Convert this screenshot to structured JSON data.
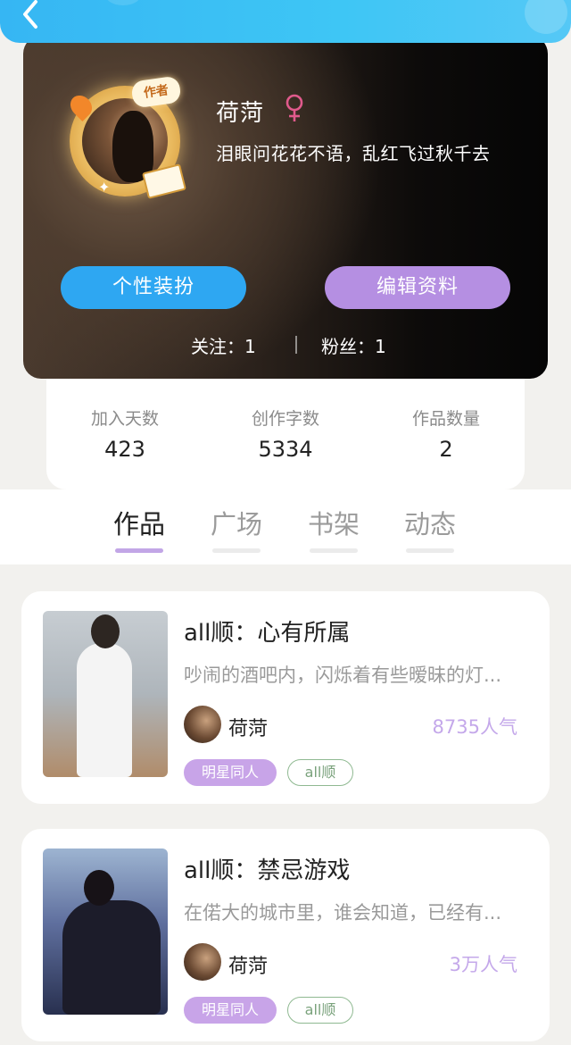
{
  "header": {
    "back_icon": "chevron-left-icon"
  },
  "profile": {
    "nickname": "荷菏",
    "gender_icon": "female-icon",
    "signature": "泪眼问花花不语，乱红飞过秋千去",
    "author_badge": "作者",
    "buttons": {
      "decorate": "个性装扮",
      "edit": "编辑资料"
    },
    "follow": "关注：1",
    "fans": "粉丝：1"
  },
  "stats": [
    {
      "label": "加入天数",
      "value": "423"
    },
    {
      "label": "创作字数",
      "value": "5334"
    },
    {
      "label": "作品数量",
      "value": "2"
    }
  ],
  "tabs": [
    {
      "label": "作品",
      "active": true
    },
    {
      "label": "广场",
      "active": false
    },
    {
      "label": "书架",
      "active": false
    },
    {
      "label": "动态",
      "active": false
    }
  ],
  "works": [
    {
      "title": "all顺：心有所属",
      "description": "吵闹的酒吧内，闪烁着有些暧昧的灯...",
      "author": "荷菏",
      "popularity": "8735人气",
      "tags": [
        "明星同人",
        "all顺"
      ]
    },
    {
      "title": "all顺：禁忌游戏",
      "description": "在偌大的城市里，谁会知道，已经有...",
      "author": "荷菏",
      "popularity": "3万人气",
      "tags": [
        "明星同人",
        "all顺"
      ]
    }
  ],
  "colors": {
    "accent_blue": "#2ea7f2",
    "accent_purple": "#b58fe2",
    "tab_active_underline": "#c2a6e6",
    "popularity": "#c4a8ea"
  }
}
